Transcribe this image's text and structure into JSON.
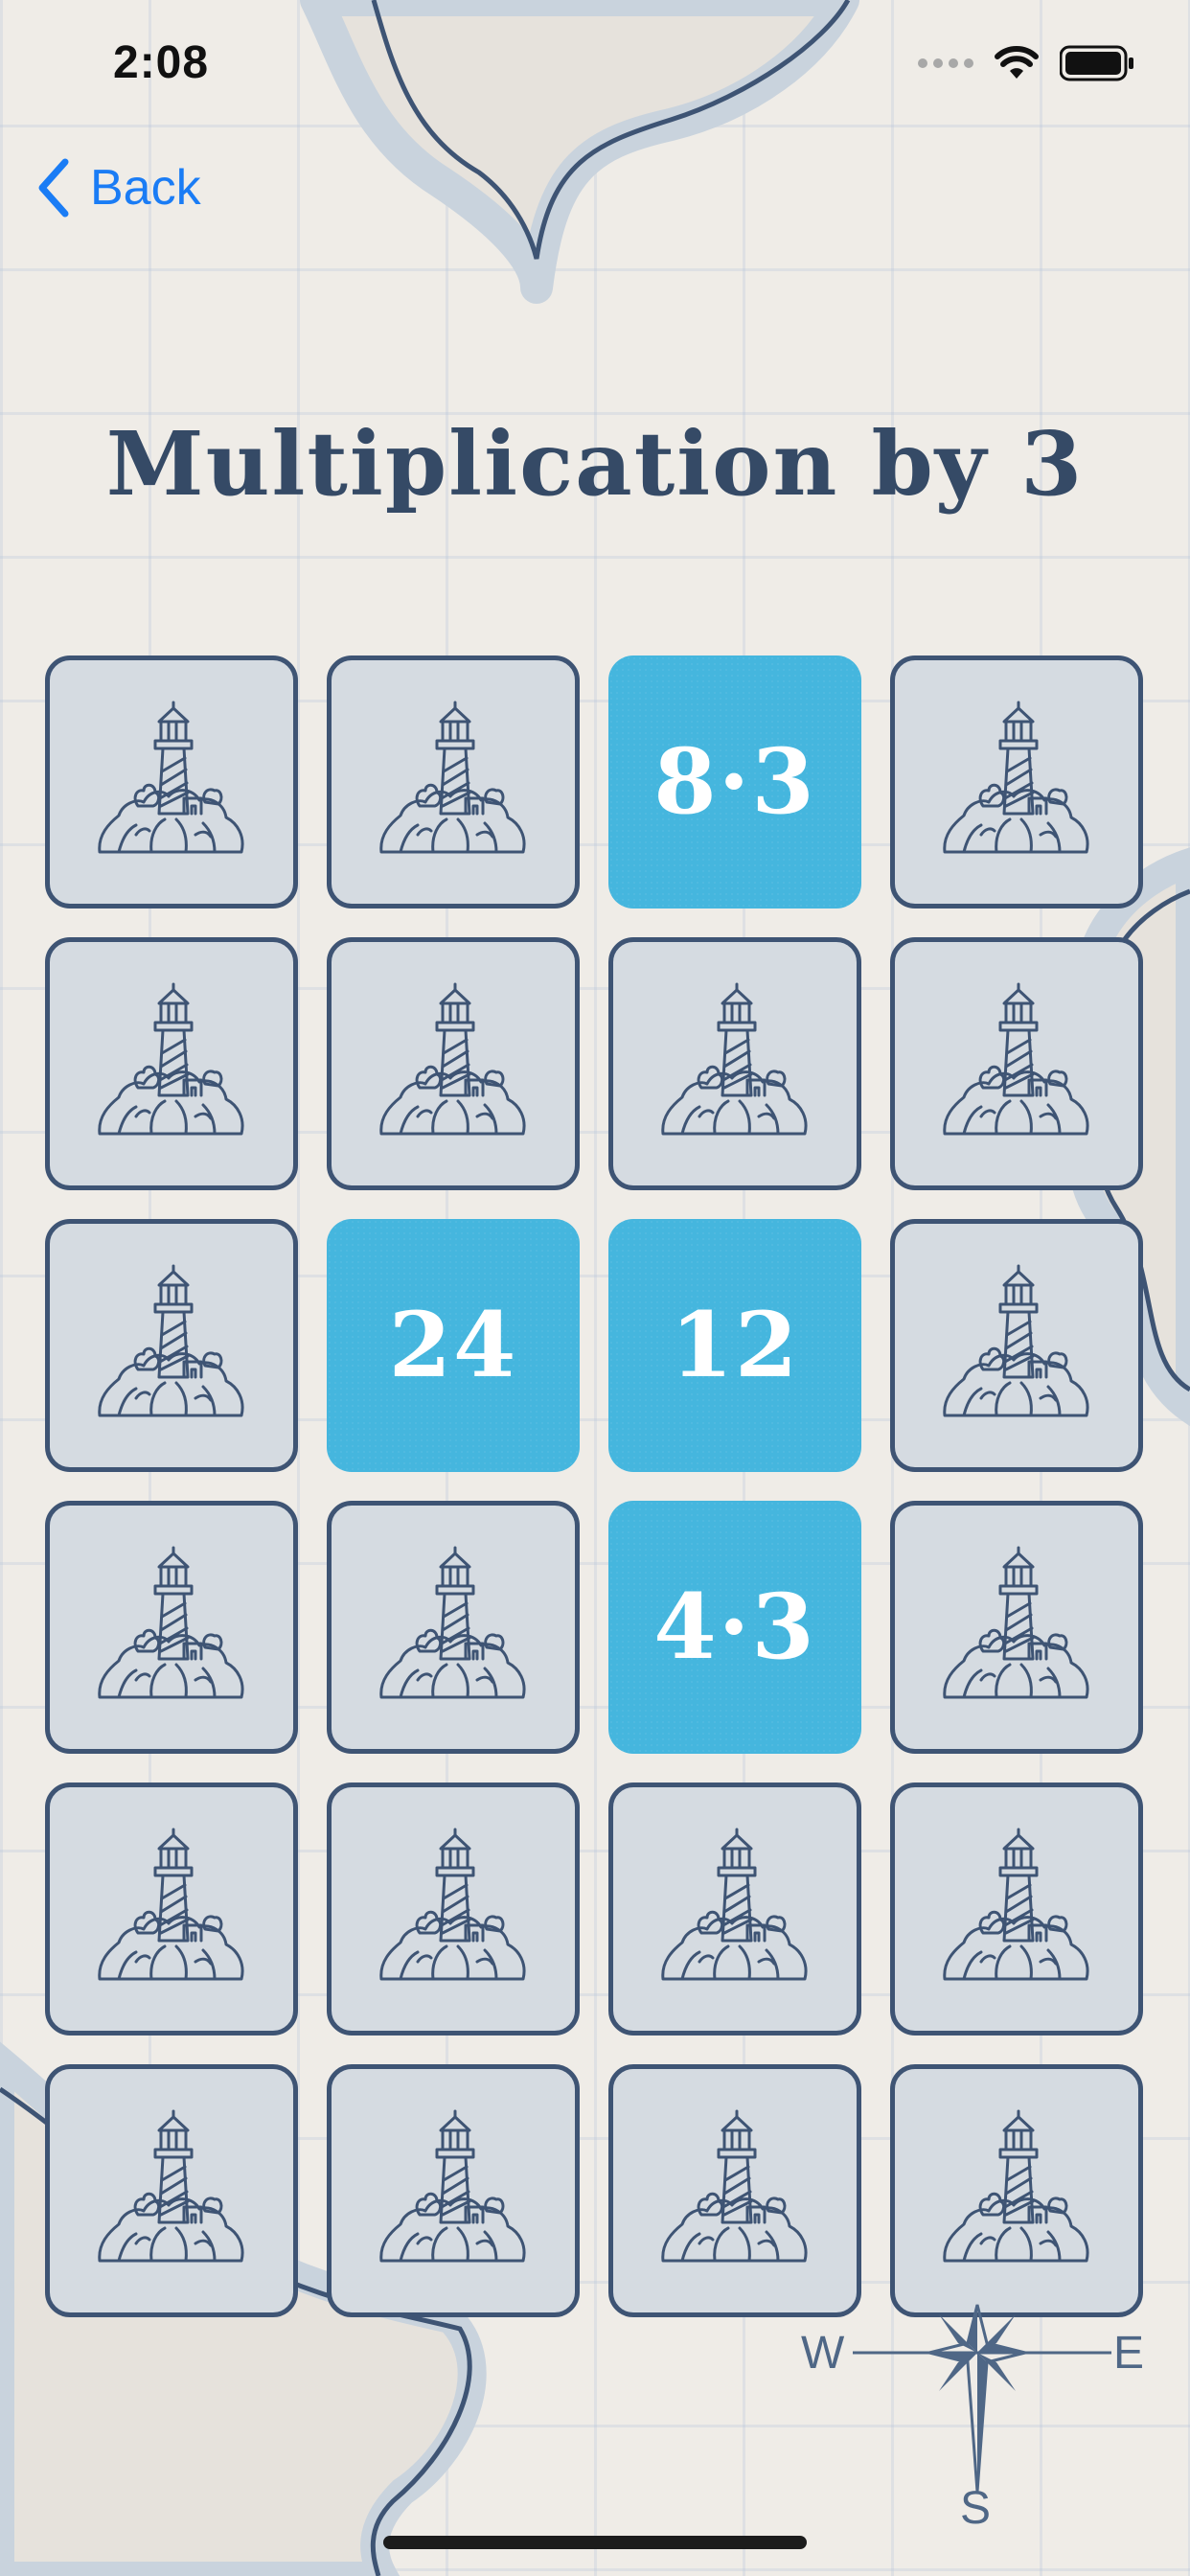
{
  "status_bar": {
    "time": "2:08"
  },
  "nav": {
    "back_label": "Back"
  },
  "title": "Multiplication by 3",
  "board": {
    "cards": [
      {
        "face_up": false,
        "text": ""
      },
      {
        "face_up": false,
        "text": ""
      },
      {
        "face_up": true,
        "text": "8·3"
      },
      {
        "face_up": false,
        "text": ""
      },
      {
        "face_up": false,
        "text": ""
      },
      {
        "face_up": false,
        "text": ""
      },
      {
        "face_up": false,
        "text": ""
      },
      {
        "face_up": false,
        "text": ""
      },
      {
        "face_up": false,
        "text": ""
      },
      {
        "face_up": true,
        "text": "24"
      },
      {
        "face_up": true,
        "text": "12"
      },
      {
        "face_up": false,
        "text": ""
      },
      {
        "face_up": false,
        "text": ""
      },
      {
        "face_up": false,
        "text": ""
      },
      {
        "face_up": true,
        "text": "4·3"
      },
      {
        "face_up": false,
        "text": ""
      },
      {
        "face_up": false,
        "text": ""
      },
      {
        "face_up": false,
        "text": ""
      },
      {
        "face_up": false,
        "text": ""
      },
      {
        "face_up": false,
        "text": ""
      },
      {
        "face_up": false,
        "text": ""
      },
      {
        "face_up": false,
        "text": ""
      },
      {
        "face_up": false,
        "text": ""
      },
      {
        "face_up": false,
        "text": ""
      }
    ]
  },
  "compass": {
    "west": "W",
    "east": "E",
    "south": "S"
  },
  "colors": {
    "card_back": "#d5dbe1",
    "card_border": "#3e5474",
    "card_face": "#45b6de",
    "title": "#354a66",
    "accent": "#1a7cf5"
  }
}
